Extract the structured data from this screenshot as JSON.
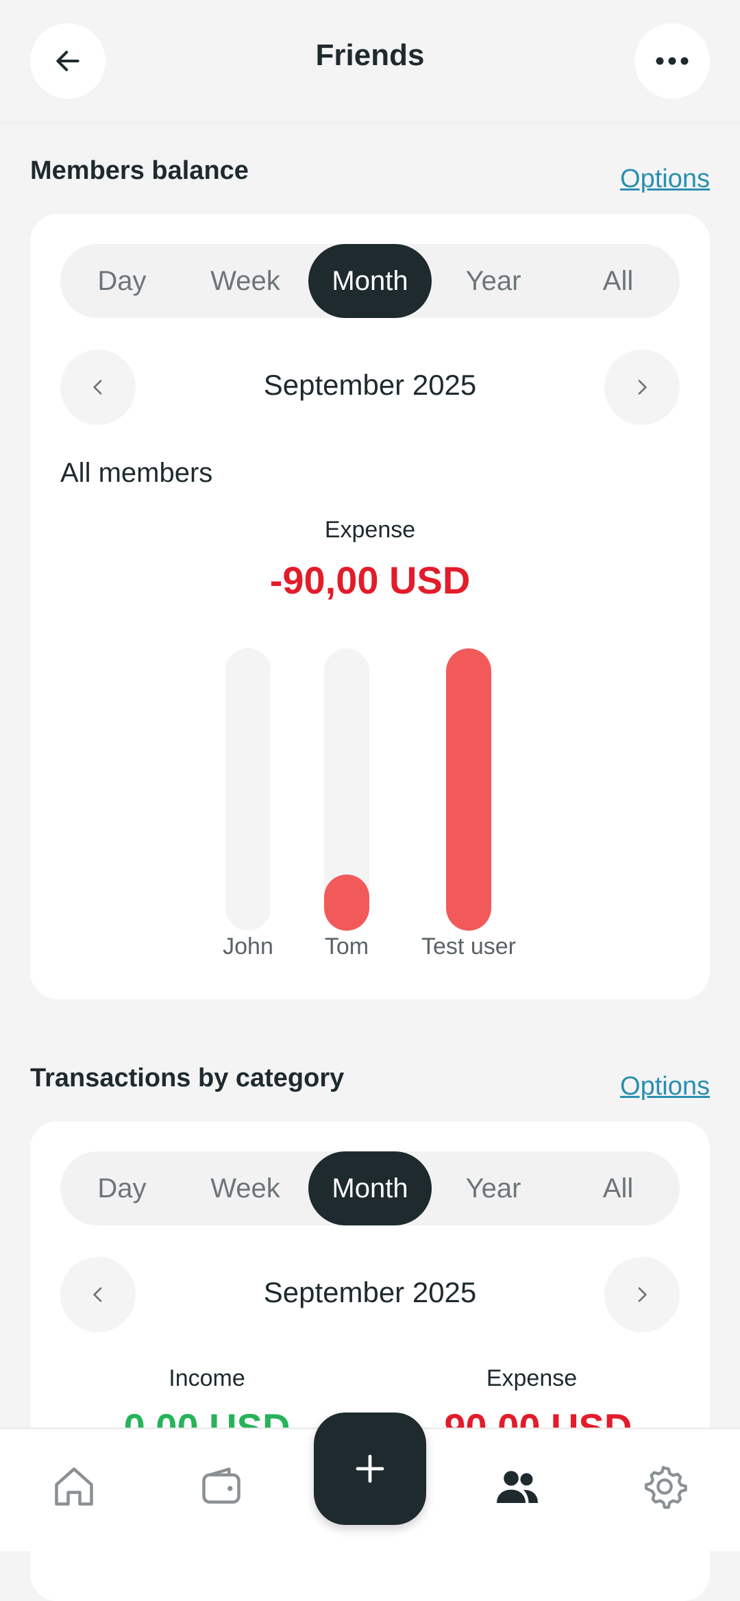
{
  "header": {
    "title": "Friends"
  },
  "members_balance": {
    "title": "Members balance",
    "options_label": "Options",
    "periods": [
      "Day",
      "Week",
      "Month",
      "Year",
      "All"
    ],
    "active_period": "Month",
    "date": "September 2025",
    "group_label": "All members",
    "expense_label": "Expense",
    "expense_value": "-90,00 USD",
    "bars": [
      {
        "name": "John",
        "fraction": 0.0
      },
      {
        "name": "Tom",
        "fraction": 0.2
      },
      {
        "name": "Test user",
        "fraction": 1.0
      }
    ]
  },
  "transactions_by_category": {
    "title": "Transactions by category",
    "options_label": "Options",
    "periods": [
      "Day",
      "Week",
      "Month",
      "Year",
      "All"
    ],
    "active_period": "Month",
    "date": "September 2025",
    "income_label": "Income",
    "income_value": "0,00 USD",
    "expense_label": "Expense",
    "expense_value": "-90,00 USD"
  },
  "colors": {
    "dark": "#1e2a2e",
    "expense_red": "#e21c2a",
    "bar_red": "#f25a5a",
    "income_green": "#27b35a",
    "link": "#2a8fb0"
  },
  "bottom_nav": {
    "items": [
      "home-icon",
      "wallet-icon",
      "add-icon",
      "friends-icon",
      "settings-icon"
    ],
    "active": "friends-icon"
  }
}
